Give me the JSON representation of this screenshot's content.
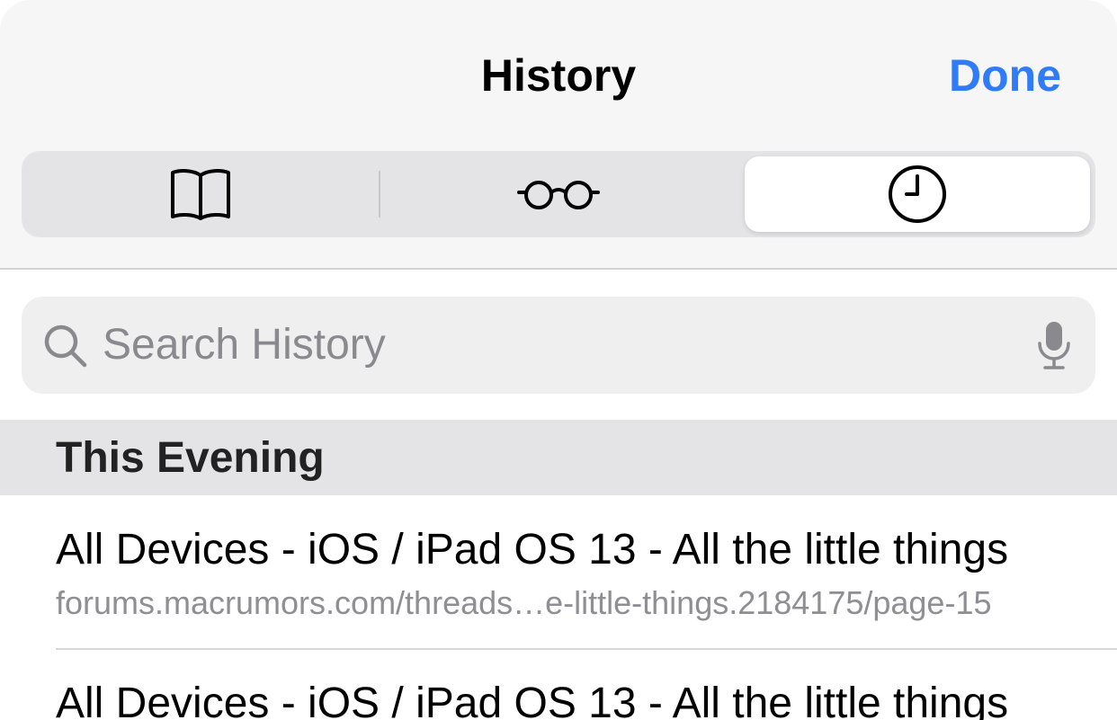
{
  "header": {
    "title": "History",
    "done_label": "Done"
  },
  "segments": [
    {
      "name": "bookmarks",
      "icon": "book-icon",
      "selected": false
    },
    {
      "name": "reading-list",
      "icon": "glasses-icon",
      "selected": false
    },
    {
      "name": "history",
      "icon": "clock-icon",
      "selected": true
    }
  ],
  "search": {
    "placeholder": "Search History",
    "value": "",
    "icon": "search-icon",
    "mic_icon": "microphone-icon"
  },
  "sections": [
    {
      "title": "This Evening",
      "items": [
        {
          "title": "All Devices - iOS / iPad OS 13 - All the little things",
          "url": "forums.macrumors.com/threads…e-little-things.2184175/page-15"
        },
        {
          "title": "All Devices - iOS / iPad OS 13 - All the little things",
          "url": ""
        }
      ]
    }
  ],
  "colors": {
    "accent": "#2f7cf6",
    "header_bg": "#f6f6f6",
    "segment_bg": "#e4e4e6",
    "section_bg": "#e4e4e6",
    "secondary_text": "#8e8e93"
  }
}
